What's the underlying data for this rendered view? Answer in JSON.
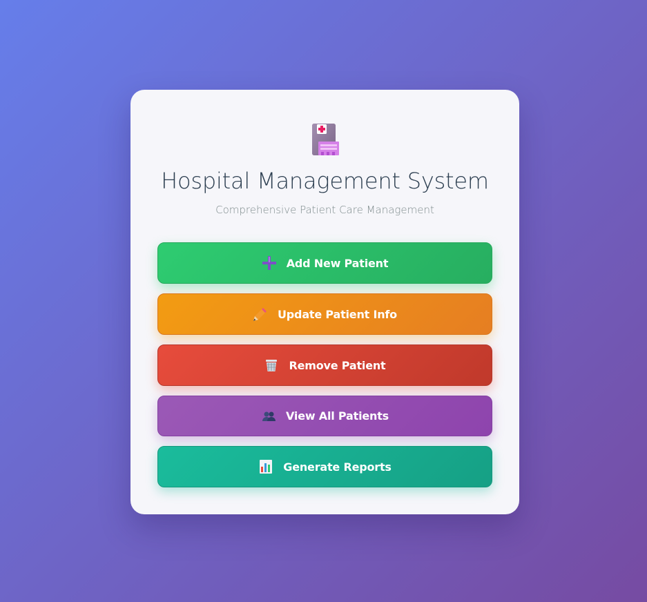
{
  "header": {
    "logo_icon": "hospital-icon",
    "title": "Hospital Management System",
    "subtitle": "Comprehensive Patient Care Management"
  },
  "actions": [
    {
      "label": "Add New Patient",
      "icon": "plus-icon",
      "color": "#2ecc71"
    },
    {
      "label": "Update Patient Info",
      "icon": "pencil-icon",
      "color": "#f39c12"
    },
    {
      "label": "Remove Patient",
      "icon": "trash-icon",
      "color": "#e74c3c"
    },
    {
      "label": "View All Patients",
      "icon": "users-icon",
      "color": "#9b59b6"
    },
    {
      "label": "Generate Reports",
      "icon": "chart-icon",
      "color": "#1abc9c"
    }
  ],
  "theme": {
    "background_start": "#667eea",
    "background_end": "#764ba2",
    "card_background": "#f6f6fa"
  }
}
